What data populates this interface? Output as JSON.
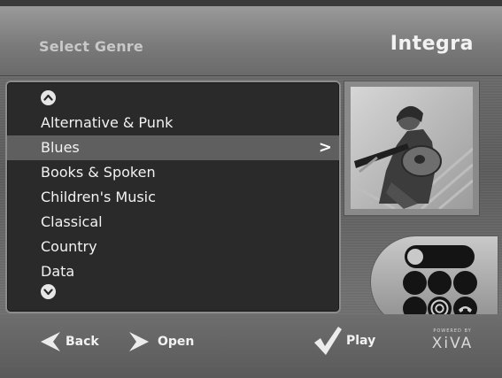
{
  "header": {
    "title": "Select Genre",
    "brand": "Integra"
  },
  "genres": {
    "items": [
      {
        "label": "Alternative & Punk",
        "selected": false
      },
      {
        "label": "Blues",
        "selected": true
      },
      {
        "label": "Books & Spoken",
        "selected": false
      },
      {
        "label": "Children's Music",
        "selected": false
      },
      {
        "label": "Classical",
        "selected": false
      },
      {
        "label": "Country",
        "selected": false
      },
      {
        "label": "Data",
        "selected": false
      }
    ],
    "selected_indicator": ">"
  },
  "nav": {
    "back_label": "Back",
    "open_label": "Open",
    "play_label": "Play"
  },
  "footer": {
    "powered_by": "POWERED BY",
    "logo": "XiVA"
  },
  "icons": {
    "scroll_up": "chevron-up-icon",
    "scroll_down": "chevron-down-icon",
    "back": "back-arrow-icon",
    "open": "open-arrow-icon",
    "play": "checkmark-icon",
    "remote_target": "target-icon",
    "remote_phone": "phone-icon"
  },
  "colors": {
    "list_background": "#2a2a2a",
    "selected_row": "#5f5f5f",
    "text": "#f2f2f2"
  }
}
